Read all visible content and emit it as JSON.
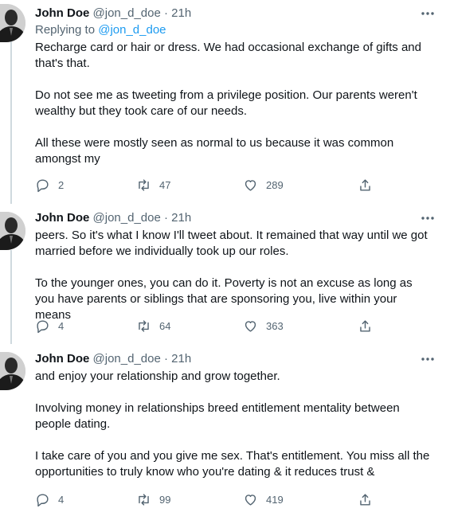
{
  "tweets": [
    {
      "name": "John Doe",
      "handle": "@jon_d_doe",
      "separator": "·",
      "time": "21h",
      "replying_label": "Replying to",
      "replying_handle": "@jon_d_doe",
      "paragraphs": [
        "Recharge card or hair or dress. We had occasional exchange of gifts and that's that.",
        "Do not see me as tweeting from a privilege position. Our parents weren't wealthy but they took care of our needs.",
        "All these were mostly seen as normal to us because it was common amongst my"
      ],
      "replies": "2",
      "retweets": "47",
      "likes": "289"
    },
    {
      "name": "John Doe",
      "handle": "@jon_d_doe",
      "separator": "·",
      "time": "21h",
      "paragraphs": [
        "peers. So it's what I know I'll tweet about. It remained that way until we got married before we individually took up our roles.",
        "To the younger ones, you can do it. Poverty is not an excuse as long as you have parents or siblings that are sponsoring you, live within your means"
      ],
      "replies": "4",
      "retweets": "64",
      "likes": "363"
    },
    {
      "name": "John Doe",
      "handle": "@jon_d_doe",
      "separator": "·",
      "time": "21h",
      "paragraphs": [
        "and enjoy your relationship and grow together.",
        "Involving money in relationships breed entitlement mentality between people dating.",
        "I take care of you and you give me sex. That's entitlement. You miss all the opportunities to truly know who you're dating & it reduces trust &"
      ],
      "replies": "4",
      "retweets": "99",
      "likes": "419"
    }
  ],
  "icons": {
    "more": "more-options-icon",
    "reply": "reply-icon",
    "retweet": "retweet-icon",
    "like": "like-icon",
    "share": "share-icon"
  },
  "colors": {
    "text": "#0f1419",
    "secondary": "#536471",
    "link": "#1d9bf0",
    "thread_line": "#cfd9de"
  }
}
